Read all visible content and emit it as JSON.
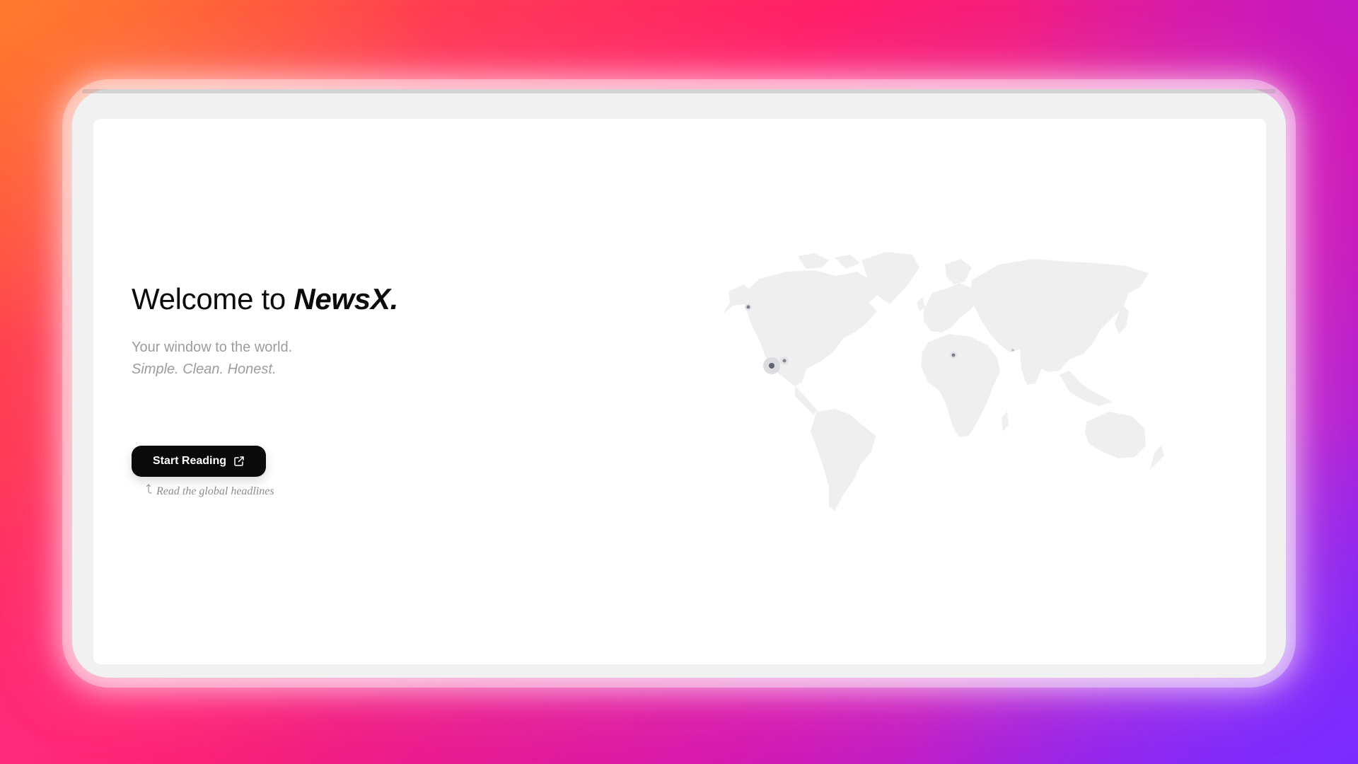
{
  "hero": {
    "title_prefix": "Welcome to ",
    "brand": "NewsX.",
    "tagline_line1": "Your window to the world.",
    "tagline_line2": "Simple. Clean. Honest."
  },
  "cta": {
    "label": "Start Reading",
    "icon": "external-link-icon",
    "hint": "Read the global headlines",
    "hint_icon": "arrow-up-icon"
  },
  "map": {
    "icon": "world-map",
    "markers": 5
  },
  "colors": {
    "button_bg": "#0a0a0a",
    "button_text": "#ffffff",
    "title": "#0b0b0b",
    "muted_text": "#9c9c9c",
    "map_fill": "#ededed",
    "marker": "#5f6470"
  }
}
